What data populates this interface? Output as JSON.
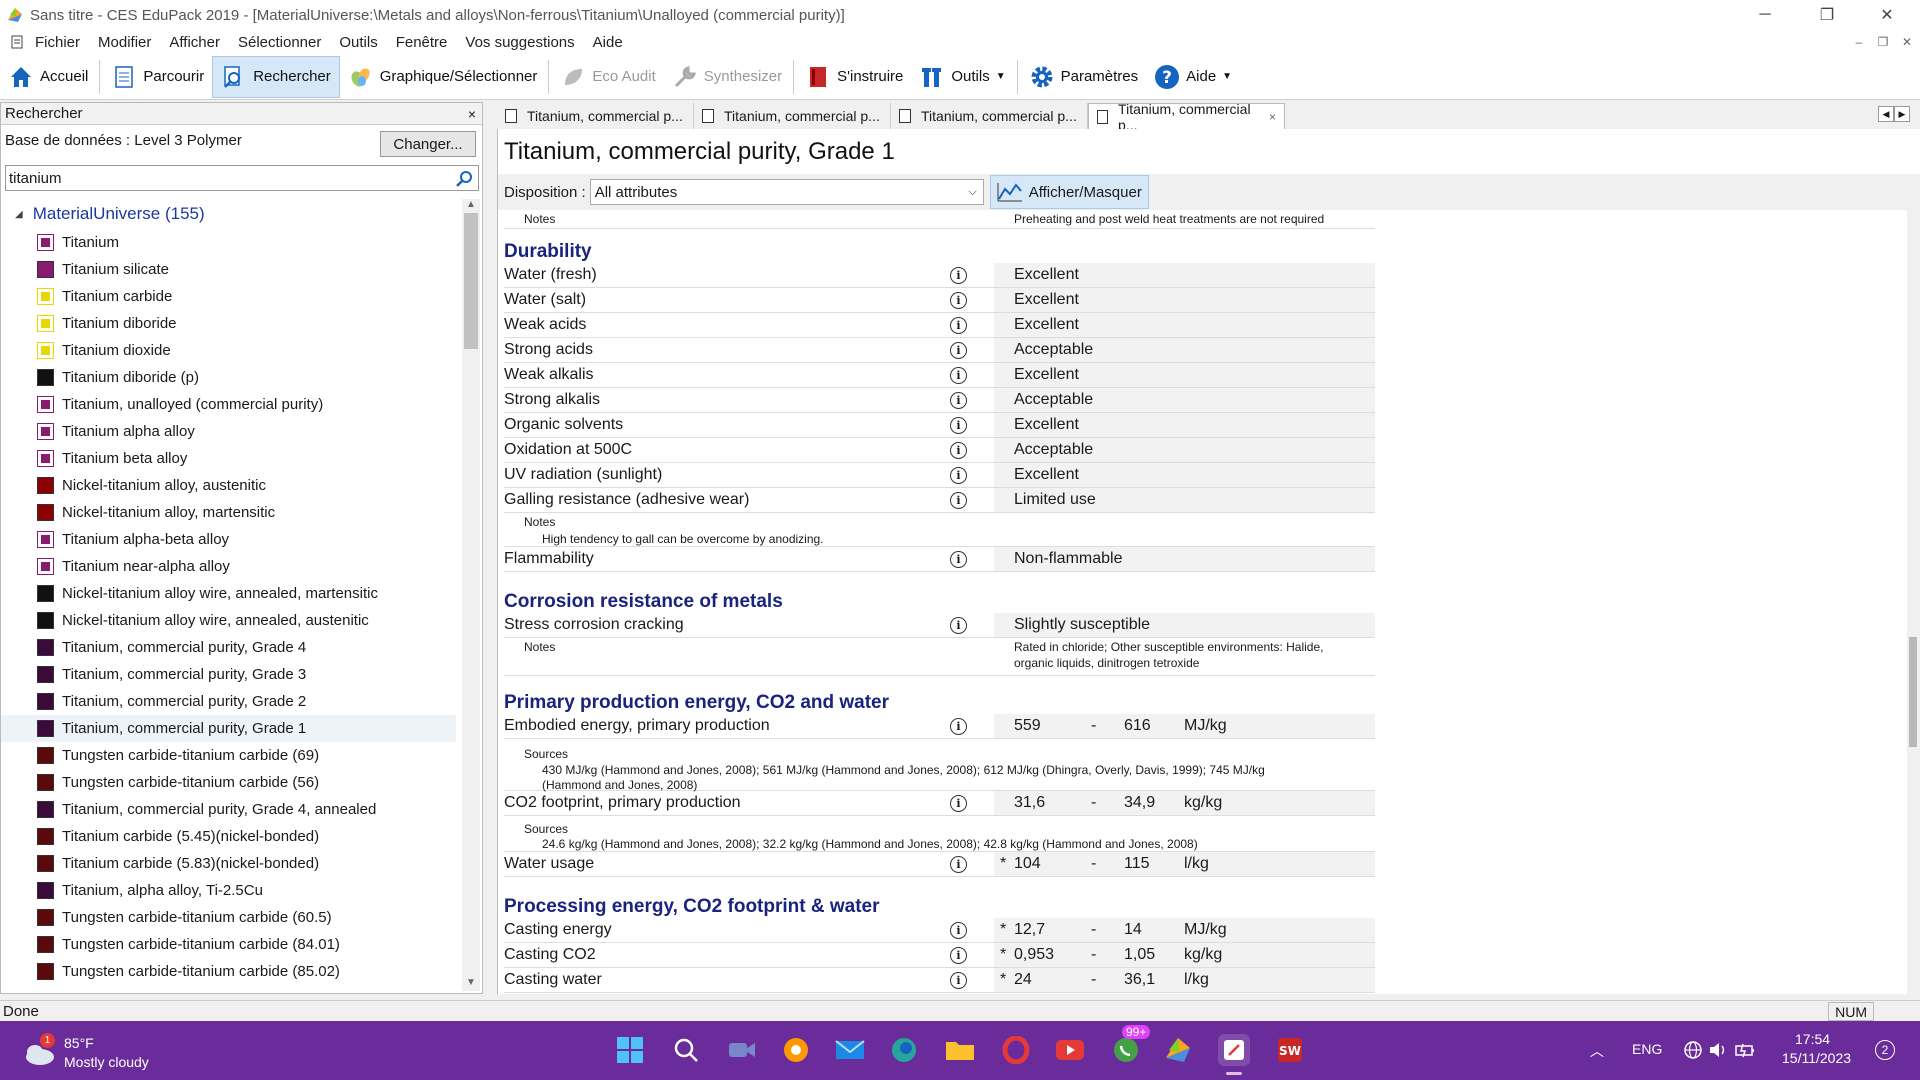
{
  "window": {
    "title": "Sans titre - CES EduPack 2019 - [MaterialUniverse:\\Metals and alloys\\Non-ferrous\\Titanium\\Unalloyed (commercial purity)]"
  },
  "menu": [
    "Fichier",
    "Modifier",
    "Afficher",
    "Sélectionner",
    "Outils",
    "Fenêtre",
    "Vos suggestions",
    "Aide"
  ],
  "toolbar": {
    "accueil": "Accueil",
    "parcourir": "Parcourir",
    "rechercher": "Rechercher",
    "graphique": "Graphique/Sélectionner",
    "eco": "Eco Audit",
    "synth": "Synthesizer",
    "sinstruire": "S'instruire",
    "outils": "Outils",
    "parametres": "Paramètres",
    "aide": "Aide"
  },
  "left": {
    "header": "Rechercher",
    "close": "×",
    "database": "Base de données : Level 3 Polymer",
    "change_button": "Changer...",
    "search_value": "titanium",
    "root": "MaterialUniverse (155)",
    "items": [
      {
        "label": "Titanium",
        "color": "#8a1a6e",
        "style": "book"
      },
      {
        "label": "Titanium silicate",
        "color": "#8a1a6e",
        "style": "solid"
      },
      {
        "label": "Titanium carbide",
        "color": "#e8d800",
        "style": "book"
      },
      {
        "label": "Titanium diboride",
        "color": "#e8d800",
        "style": "book"
      },
      {
        "label": "Titanium dioxide",
        "color": "#e8d800",
        "style": "book"
      },
      {
        "label": "Titanium diboride (p)",
        "color": "#111",
        "style": "solid"
      },
      {
        "label": "Titanium, unalloyed (commercial purity)",
        "color": "#8a1a6e",
        "style": "book"
      },
      {
        "label": "Titanium alpha alloy",
        "color": "#8a1a6e",
        "style": "book"
      },
      {
        "label": "Titanium beta alloy",
        "color": "#8a1a6e",
        "style": "book"
      },
      {
        "label": "Nickel-titanium alloy, austenitic",
        "color": "#8b0000",
        "style": "solid"
      },
      {
        "label": "Nickel-titanium alloy, martensitic",
        "color": "#8b0000",
        "style": "solid"
      },
      {
        "label": "Titanium alpha-beta alloy",
        "color": "#8a1a6e",
        "style": "book"
      },
      {
        "label": "Titanium near-alpha alloy",
        "color": "#8a1a6e",
        "style": "book"
      },
      {
        "label": "Nickel-titanium alloy wire, annealed, martensitic",
        "color": "#111",
        "style": "solid"
      },
      {
        "label": "Nickel-titanium alloy wire, annealed, austenitic",
        "color": "#111",
        "style": "solid"
      },
      {
        "label": "Titanium, commercial purity, Grade 4",
        "color": "#3a0a3a",
        "style": "solid"
      },
      {
        "label": "Titanium, commercial purity, Grade 3",
        "color": "#3a0a3a",
        "style": "solid"
      },
      {
        "label": "Titanium, commercial purity, Grade 2",
        "color": "#3a0a3a",
        "style": "solid"
      },
      {
        "label": "Titanium, commercial purity, Grade 1",
        "color": "#3a0a3a",
        "style": "solid",
        "selected": true
      },
      {
        "label": "Tungsten carbide-titanium carbide (69)",
        "color": "#5a0a0a",
        "style": "solid"
      },
      {
        "label": "Tungsten carbide-titanium carbide (56)",
        "color": "#5a0a0a",
        "style": "solid"
      },
      {
        "label": "Titanium, commercial purity, Grade 4, annealed",
        "color": "#3a0a3a",
        "style": "solid"
      },
      {
        "label": "Titanium carbide (5.45)(nickel-bonded)",
        "color": "#5a0a0a",
        "style": "solid"
      },
      {
        "label": "Titanium carbide (5.83)(nickel-bonded)",
        "color": "#5a0a0a",
        "style": "solid"
      },
      {
        "label": "Titanium, alpha alloy, Ti-2.5Cu",
        "color": "#3a0a3a",
        "style": "solid"
      },
      {
        "label": "Tungsten carbide-titanium carbide (60.5)",
        "color": "#5a0a0a",
        "style": "solid"
      },
      {
        "label": "Tungsten carbide-titanium carbide (84.01)",
        "color": "#5a0a0a",
        "style": "solid"
      },
      {
        "label": "Tungsten carbide-titanium carbide (85.02)",
        "color": "#5a0a0a",
        "style": "solid"
      }
    ]
  },
  "tabs": [
    "Titanium, commercial p...",
    "Titanium, commercial p...",
    "Titanium, commercial p...",
    "Titanium, commercial p..."
  ],
  "tab_close": "×",
  "doc": {
    "title": "Titanium, commercial purity, Grade 1",
    "disposition_label": "Disposition :",
    "disposition_value": "All attributes",
    "afficher": "Afficher/Masquer",
    "top_notes_label": "Notes",
    "top_notes": "Preheating and post weld heat treatments are not required",
    "durability_title": "Durability",
    "durability": [
      {
        "name": "Water (fresh)",
        "value": "Excellent"
      },
      {
        "name": "Water (salt)",
        "value": "Excellent"
      },
      {
        "name": "Weak acids",
        "value": "Excellent"
      },
      {
        "name": "Strong acids",
        "value": "Acceptable"
      },
      {
        "name": "Weak alkalis",
        "value": "Excellent"
      },
      {
        "name": "Strong alkalis",
        "value": "Acceptable"
      },
      {
        "name": "Organic solvents",
        "value": "Excellent"
      },
      {
        "name": "Oxidation at 500C",
        "value": "Acceptable"
      },
      {
        "name": "UV radiation (sunlight)",
        "value": "Excellent"
      },
      {
        "name": "Galling resistance (adhesive wear)",
        "value": "Limited use"
      }
    ],
    "galling_notes_label": "Notes",
    "galling_notes": "High tendency to gall can be overcome by anodizing.",
    "flammability": {
      "name": "Flammability",
      "value": "Non-flammable"
    },
    "corrosion_title": "Corrosion resistance of metals",
    "scc": {
      "name": "Stress corrosion cracking",
      "value": "Slightly susceptible"
    },
    "scc_notes_label": "Notes",
    "scc_notes_1": "Rated in chloride; Other susceptible environments: Halide,",
    "scc_notes_2": "organic liquids, dinitrogen tetroxide",
    "primary_title": "Primary production energy, CO2 and water",
    "embodied": {
      "name": "Embodied energy, primary production",
      "min": "559",
      "dash": "-",
      "max": "616",
      "unit": "MJ/kg"
    },
    "embodied_sources_label": "Sources",
    "embodied_sources_1": "430 MJ/kg (Hammond and Jones, 2008);  561 MJ/kg (Hammond and Jones, 2008);  612 MJ/kg (Dhingra, Overly, Davis, 1999);  745 MJ/kg",
    "embodied_sources_2": "(Hammond and Jones, 2008)",
    "co2": {
      "name": "CO2 footprint, primary production",
      "min": "31,6",
      "dash": "-",
      "max": "34,9",
      "unit": "kg/kg"
    },
    "co2_sources_label": "Sources",
    "co2_sources": "24.6 kg/kg (Hammond and Jones, 2008);  32.2 kg/kg (Hammond and Jones, 2008);  42.8 kg/kg (Hammond and Jones, 2008)",
    "water": {
      "name": "Water usage",
      "star": "*",
      "min": "104",
      "dash": "-",
      "max": "115",
      "unit": "l/kg"
    },
    "processing_title": "Processing energy, CO2 footprint & water",
    "casting": [
      {
        "name": "Casting energy",
        "star": "*",
        "min": "12,7",
        "dash": "-",
        "max": "14",
        "unit": "MJ/kg"
      },
      {
        "name": "Casting CO2",
        "star": "*",
        "min": "0,953",
        "dash": "-",
        "max": "1,05",
        "unit": "kg/kg"
      },
      {
        "name": "Casting water",
        "star": "*",
        "min": "24",
        "dash": "-",
        "max": "36,1",
        "unit": "l/kg"
      }
    ]
  },
  "status": {
    "text": "Done",
    "num": "NUM"
  },
  "taskbar": {
    "weather_temp": "85°F",
    "weather_desc": "Mostly cloudy",
    "weather_badge": "1",
    "whatsapp_badge": "99+",
    "lang": "ENG",
    "time": "17:54",
    "date": "15/11/2023",
    "notif": "2"
  }
}
